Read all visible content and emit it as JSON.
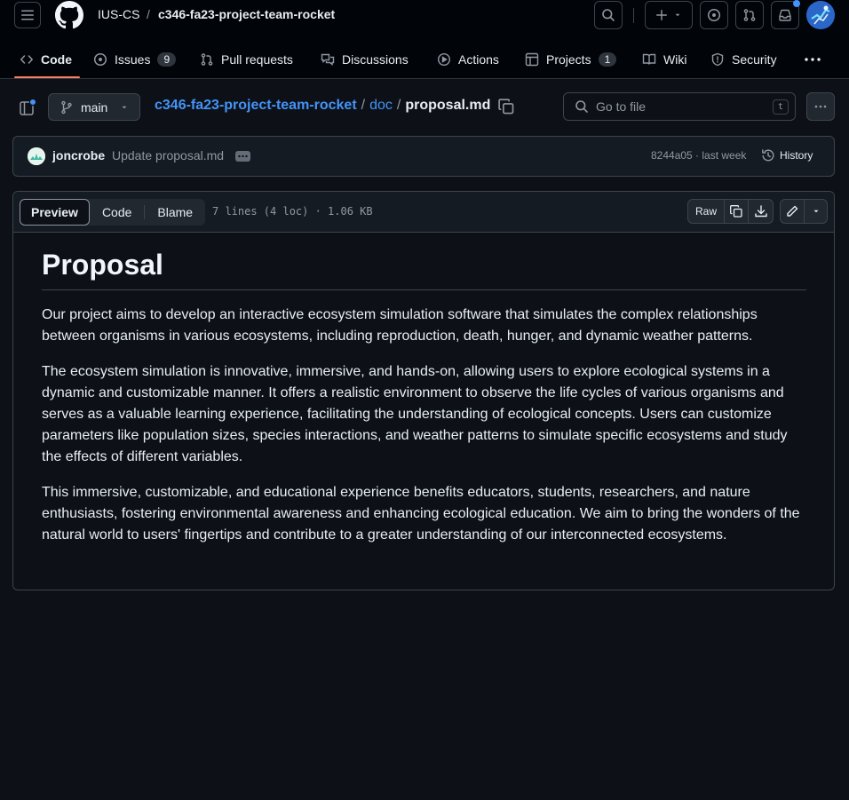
{
  "header": {
    "owner": "IUS-CS",
    "separator": "/",
    "repo": "c346-fa23-project-team-rocket"
  },
  "tabs": [
    {
      "label": "Code",
      "icon": "code-icon",
      "active": true
    },
    {
      "label": "Issues",
      "icon": "issue-opened-icon",
      "count": "9"
    },
    {
      "label": "Pull requests",
      "icon": "git-pull-request-icon"
    },
    {
      "label": "Discussions",
      "icon": "comment-discussion-icon"
    },
    {
      "label": "Actions",
      "icon": "play-icon"
    },
    {
      "label": "Projects",
      "icon": "table-icon",
      "count": "1"
    },
    {
      "label": "Wiki",
      "icon": "book-icon"
    },
    {
      "label": "Security",
      "icon": "shield-icon"
    }
  ],
  "file_nav": {
    "branch": "main",
    "path_repo": "c346-fa23-project-team-rocket",
    "path_sep": "/",
    "path_dir": "doc",
    "file_name": "proposal.md",
    "goto_placeholder": "Go to file",
    "goto_shortcut": "t"
  },
  "commit": {
    "author": "joncrobe",
    "message": "Update proposal.md",
    "sha_time": "8244a05 · last week",
    "history_label": "History"
  },
  "file_view": {
    "modes": [
      "Preview",
      "Code",
      "Blame"
    ],
    "meta": "7 lines (4 loc) · 1.06 KB",
    "raw_label": "Raw"
  },
  "document": {
    "title": "Proposal",
    "paragraphs": [
      "Our project aims to develop an interactive ecosystem simulation software that simulates the complex relationships between organisms in various ecosystems, including reproduction, death, hunger, and dynamic weather patterns.",
      "The ecosystem simulation is innovative, immersive, and hands-on, allowing users to explore ecological systems in a dynamic and customizable manner. It offers a realistic environment to observe the life cycles of various organisms and serves as a valuable learning experience, facilitating the understanding of ecological concepts. Users can customize parameters like population sizes, species interactions, and weather patterns to simulate specific ecosystems and study the effects of different variables.",
      "This immersive, customizable, and educational experience benefits educators, students, researchers, and nature enthusiasts, fostering environmental awareness and enhancing ecological education. We aim to bring the wonders of the natural world to users' fingertips and contribute to a greater understanding of our interconnected ecosystems."
    ]
  },
  "colors": {
    "background": "#0d1117",
    "header_bg": "#010409",
    "link": "#4493f8",
    "active_tab_underline": "#f78166",
    "notification_dot": "#4493f8"
  }
}
